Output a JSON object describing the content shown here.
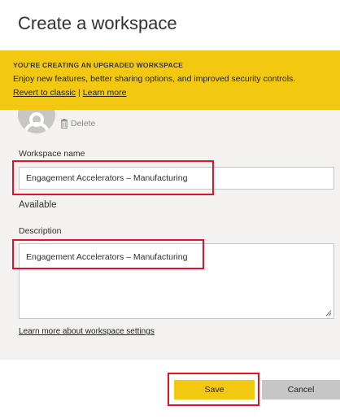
{
  "dialog": {
    "title": "Create a workspace"
  },
  "banner": {
    "title": "YOU'RE CREATING AN UPGRADED WORKSPACE",
    "text": "Enjoy new features, better sharing options, and improved security controls.",
    "revert_link": "Revert to classic",
    "separator": "|",
    "learn_link": "Learn more"
  },
  "image": {
    "delete_label": "Delete"
  },
  "workspace_name": {
    "label": "Workspace name",
    "value": "Engagement Accelerators – Manufacturing",
    "status": "Available"
  },
  "description": {
    "label": "Description",
    "value": "Engagement Accelerators – Manufacturing"
  },
  "settings_link": "Learn more about workspace settings",
  "buttons": {
    "save": "Save",
    "cancel": "Cancel"
  },
  "colors": {
    "accent_yellow": "#f2c811",
    "highlight_red": "#e81123",
    "panel_gray": "#f3f2f1"
  }
}
